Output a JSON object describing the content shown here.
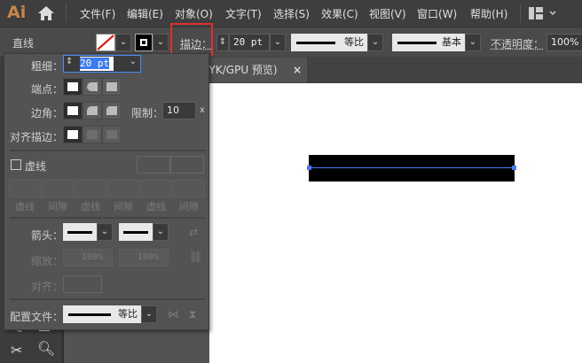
{
  "app": {
    "logo": "Ai"
  },
  "menu": [
    "文件(F)",
    "编辑(E)",
    "对象(O)",
    "文字(T)",
    "选择(S)",
    "效果(C)",
    "视图(V)",
    "窗口(W)",
    "帮助(H)"
  ],
  "control": {
    "object_type": "直线",
    "stroke_label": "描边：",
    "stroke_weight": "20 pt",
    "profile": "等比",
    "brush": "基本",
    "opacity_label": "不透明度：",
    "opacity": "100%"
  },
  "tab": {
    "title": "IYK/GPU 预览)",
    "close": "×"
  },
  "panel": {
    "weight_label": "粗细：",
    "weight": "20 pt",
    "cap_label": "端点：",
    "corner_label": "边角：",
    "limit_label": "限制：",
    "limit": "10",
    "limit_suffix": "x",
    "align_label": "对齐描边：",
    "dashed_label": "虚线",
    "dash_labels": [
      "虚线",
      "间隙",
      "虚线",
      "间隙",
      "虚线",
      "间隙"
    ],
    "arrow_label": "箭头：",
    "scale_label": "缩放：",
    "scale1": "100%",
    "scale2": "100%",
    "arrow_align_label": "对齐：",
    "profile_label": "配置文件：",
    "profile": "等比"
  },
  "colors": {
    "highlight": "#e03030",
    "selection": "#4a78ff"
  }
}
